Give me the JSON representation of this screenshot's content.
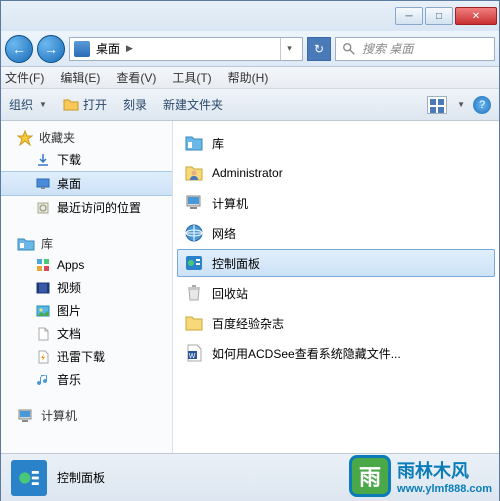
{
  "titlebar": {
    "minimize": "─",
    "maximize": "□",
    "close": "✕"
  },
  "nav": {
    "back": "←",
    "forward": "→"
  },
  "address": {
    "location": "桌面",
    "crumb_sep": "▶",
    "dropdown": "▾",
    "refresh": "↻"
  },
  "search": {
    "placeholder": "搜索 桌面"
  },
  "menu": {
    "file": "文件(F)",
    "edit": "编辑(E)",
    "view": "查看(V)",
    "tools": "工具(T)",
    "help": "帮助(H)"
  },
  "toolbar": {
    "organize": "组织",
    "open": "打开",
    "burn": "刻录",
    "newfolder": "新建文件夹",
    "help": "?"
  },
  "sidebar": {
    "favorites": {
      "label": "收藏夹",
      "items": [
        "下载",
        "桌面",
        "最近访问的位置"
      ]
    },
    "libraries": {
      "label": "库",
      "items": [
        "Apps",
        "视频",
        "图片",
        "文档",
        "迅雷下载",
        "音乐"
      ]
    },
    "computer": {
      "label": "计算机"
    }
  },
  "content": {
    "items": [
      "库",
      "Administrator",
      "计算机",
      "网络",
      "控制面板",
      "回收站",
      "百度经验杂志",
      "如何用ACDSee查看系统隐藏文件..."
    ],
    "selected_index": 4
  },
  "status": {
    "selected_label": "控制面板"
  },
  "watermark": {
    "logo_char": "雨",
    "name": "雨林木风",
    "url": "www.ylmf888.com"
  }
}
